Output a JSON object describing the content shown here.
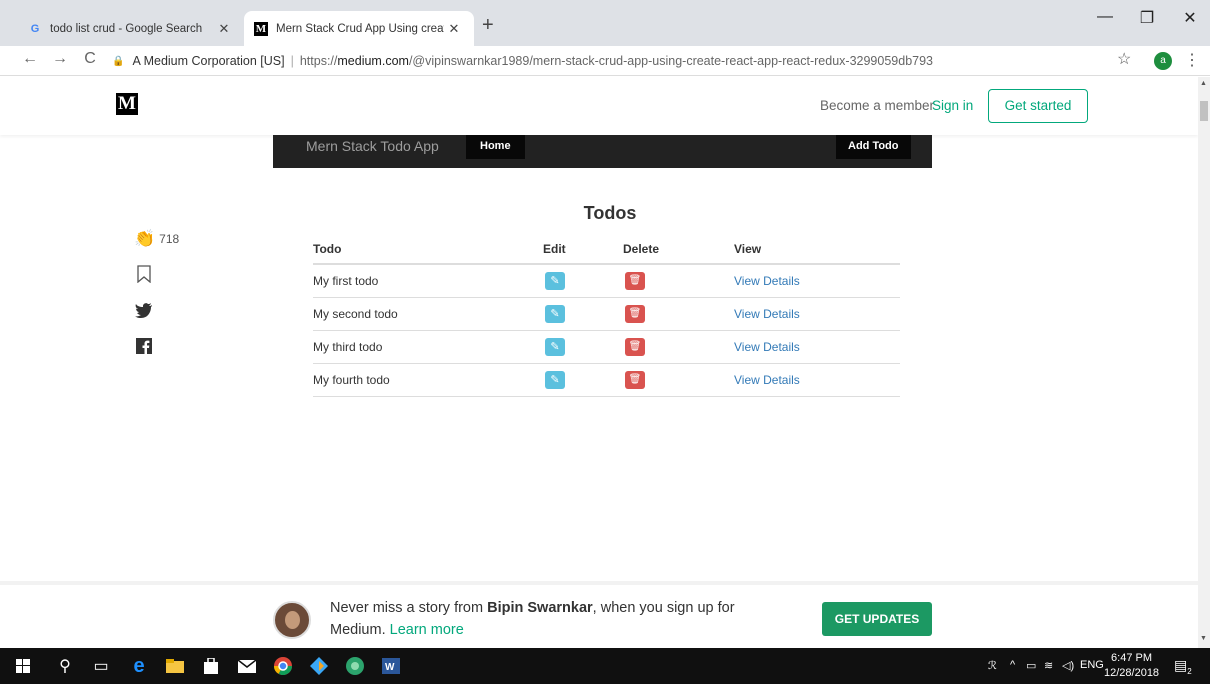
{
  "browser": {
    "tabs": [
      {
        "title": "todo list crud - Google Search",
        "icon": "google-icon"
      },
      {
        "title": "Mern Stack Crud App Using creat",
        "icon": "medium-icon"
      }
    ],
    "new_tab": "+",
    "window_controls": {
      "minimize": "—",
      "restore": "❐",
      "close": "✕"
    },
    "security_label": "A Medium Corporation [US]",
    "url_prefix": "https://",
    "url_host": "medium.com",
    "url_path": "/@vipinswarnkar1989/mern-stack-crud-app-using-create-react-app-react-redux-3299059db793",
    "profile_letter": "a"
  },
  "medium": {
    "logo": "M",
    "become_member": "Become a member",
    "sign_in": "Sign in",
    "get_started": "Get started",
    "clap_count": "718"
  },
  "app": {
    "brand": "Mern Stack Todo App",
    "home": "Home",
    "add_todo": "Add Todo",
    "title": "Todos",
    "columns": [
      "Todo",
      "Edit",
      "Delete",
      "View"
    ],
    "rows": [
      {
        "todo": "My first todo",
        "view": "View Details"
      },
      {
        "todo": "My second todo",
        "view": "View Details"
      },
      {
        "todo": "My third todo",
        "view": "View Details"
      },
      {
        "todo": "My fourth todo",
        "view": "View Details"
      }
    ]
  },
  "banner": {
    "prefix": "Never miss a story from ",
    "author": "Bipin Swarnkar",
    "middle": ", when you sign up for Medium. ",
    "learn_more": "Learn more",
    "button": "GET UPDATES"
  },
  "taskbar": {
    "lang": "ENG",
    "time": "6:47 PM",
    "date": "12/28/2018",
    "notifications": "2"
  },
  "colors": {
    "medium_green": "#03a87c",
    "edit_button": "#5bc0de",
    "delete_button": "#d9534f",
    "link_blue": "#337ab7",
    "navbar": "#222222"
  }
}
